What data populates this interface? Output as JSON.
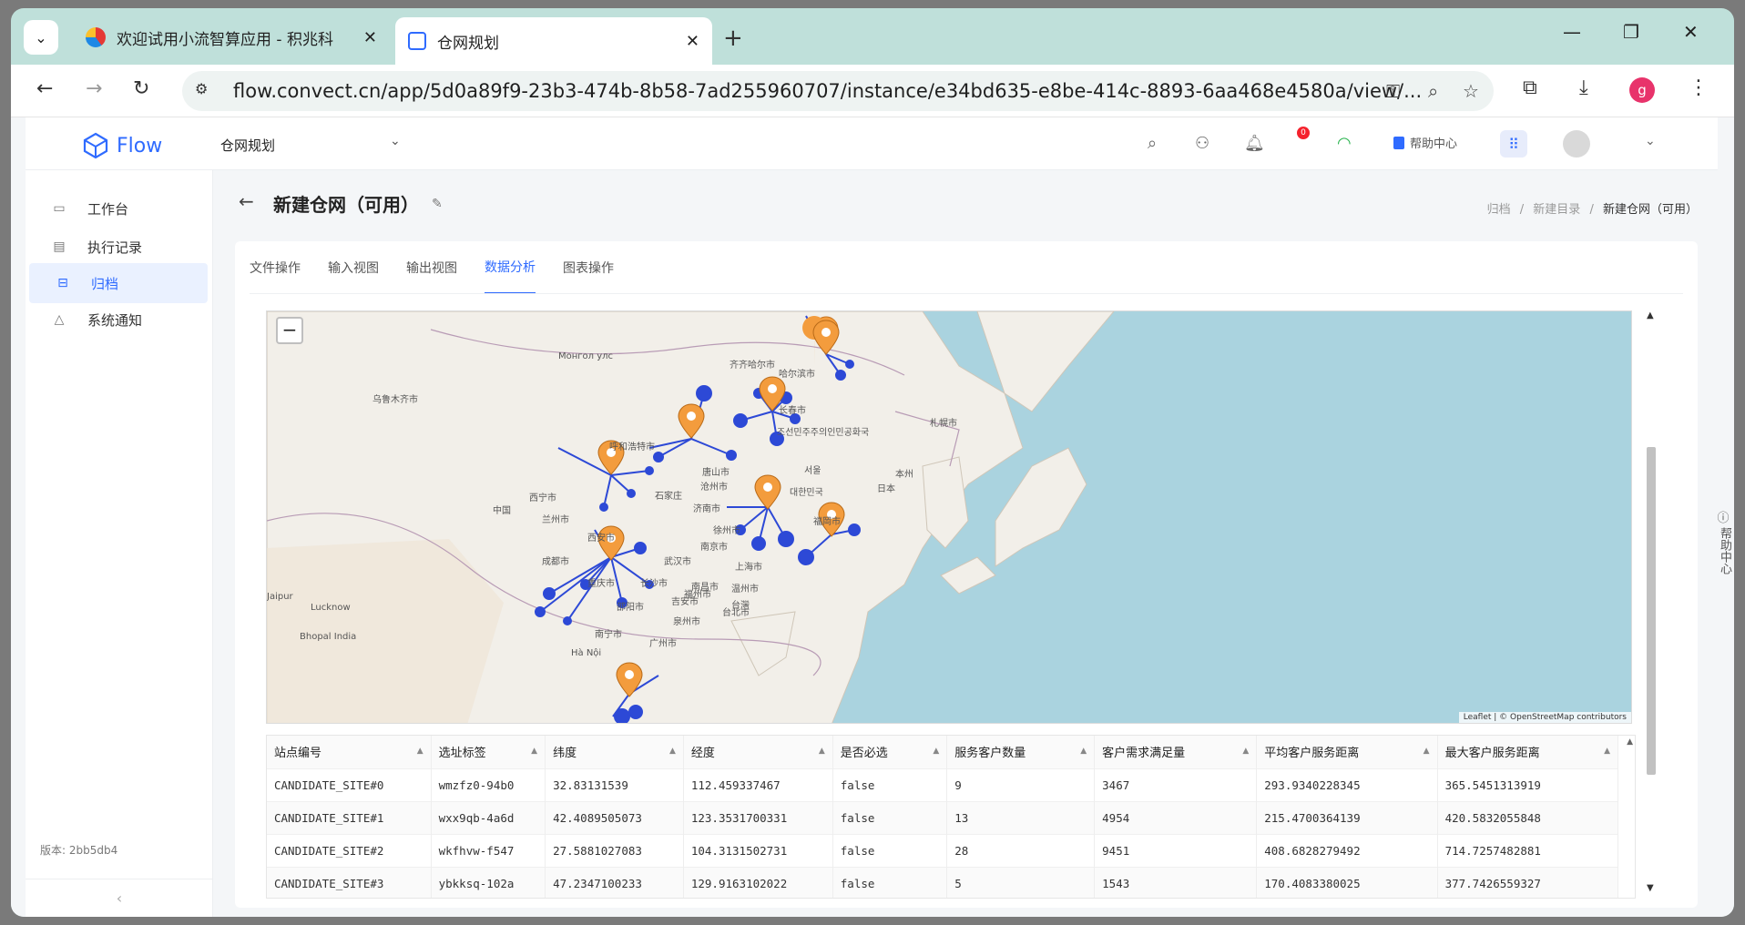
{
  "browser": {
    "tabs": [
      {
        "title": "欢迎试用小流智算应用 - 积兆科",
        "active": false
      },
      {
        "title": "仓网规划",
        "active": true
      }
    ],
    "url": "flow.convect.cn/app/5d0a89f9-23b3-474b-8b58-7ad255960707/instance/e34bd635-e8be-414c-8893-6aa468e4580a/view/...",
    "profile_initial": "g",
    "colors": {
      "frame": "#bfe0da",
      "profile": "#e8336b"
    }
  },
  "app": {
    "logo_text": "Flow",
    "project_select": "仓网规划",
    "notification_count": "0",
    "help_label": "帮助中心",
    "accent": "#2f6bff"
  },
  "sidebar": {
    "items": [
      {
        "label": "工作台",
        "icon": "dashboard-icon"
      },
      {
        "label": "执行记录",
        "icon": "clipboard-icon"
      },
      {
        "label": "归档",
        "icon": "archive-icon",
        "active": true
      },
      {
        "label": "系统通知",
        "icon": "bell-icon"
      }
    ],
    "version": "版本: 2bb5db4"
  },
  "page": {
    "title": "新建仓网（可用）",
    "breadcrumb": [
      "归档",
      "新建目录",
      "新建仓网（可用）"
    ],
    "tabs": [
      "文件操作",
      "输入视图",
      "输出视图",
      "数据分析",
      "图表操作"
    ],
    "active_tab": "数据分析",
    "right_help": "帮助中心"
  },
  "map": {
    "attribution": "Leaflet | © OpenStreetMap contributors",
    "labels": [
      "Монгол улс",
      "乌鲁木齐市",
      "齐齐哈尔市",
      "哈尔滨市",
      "长春市",
      "札幌市",
      "呼和浩特市",
      "唐山市",
      "沧州市",
      "石家庄",
      "济南市",
      "西宁市",
      "兰州市",
      "中国",
      "西安市",
      "徐州市",
      "南京市",
      "上海市",
      "成都市",
      "重庆市",
      "武汉市",
      "长沙市",
      "南昌市",
      "温州市",
      "吉安市",
      "台北市",
      "福州市",
      "泉州市",
      "邵阳市",
      "南宁市",
      "广州市",
      "Hà Nội",
      "Jaipur",
      "Lucknow",
      "Bhopal India",
      "서울",
      "대한민국",
      "日本",
      "本州",
      "福岡市",
      "조선민주주의인민공화국",
      "台灣"
    ]
  },
  "table": {
    "columns": [
      "站点编号",
      "选址标签",
      "纬度",
      "经度",
      "是否必选",
      "服务客户数量",
      "客户需求满足量",
      "平均客户服务距离",
      "最大客户服务距离"
    ],
    "rows": [
      [
        "CANDIDATE_SITE#0",
        "wmzfz0-94b0",
        "32.83131539",
        "112.459337467",
        "false",
        "9",
        "3467",
        "293.9340228345",
        "365.5451313919"
      ],
      [
        "CANDIDATE_SITE#1",
        "wxx9qb-4a6d",
        "42.4089505073",
        "123.3531700331",
        "false",
        "13",
        "4954",
        "215.4700364139",
        "420.5832055848"
      ],
      [
        "CANDIDATE_SITE#2",
        "wkfhvw-f547",
        "27.5881027083",
        "104.3131502731",
        "false",
        "28",
        "9451",
        "408.6828279492",
        "714.7257482881"
      ],
      [
        "CANDIDATE_SITE#3",
        "ybkksq-102a",
        "47.2347100233",
        "129.9163102022",
        "false",
        "5",
        "1543",
        "170.4083380025",
        "377.7426559327"
      ]
    ]
  }
}
